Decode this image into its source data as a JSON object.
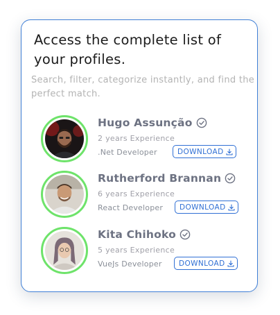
{
  "card": {
    "title": "Access the complete list of your profiles.",
    "subtitle": "Search, filter, categorize instantly, and find the perfect match."
  },
  "profiles": [
    {
      "name": "Hugo Assunção",
      "experience": "2 years Experience",
      "role": ".Net Developer",
      "download_label": "DOWNLOAD",
      "icon": "check-circle-icon"
    },
    {
      "name": "Rutherford Brannan",
      "experience": "6 years Experience",
      "role": "React Developer",
      "download_label": "DOWNLOAD",
      "icon": "check-circle-icon"
    },
    {
      "name": "Kita Chihoko",
      "experience": "5 years Experience",
      "role": "VueJs Developer",
      "download_label": "DOWNLOAD",
      "icon": "check-circle-icon"
    }
  ],
  "colors": {
    "accent": "#2f6fd4",
    "card_border": "#3f7fd6",
    "avatar_ring": "#6ee36a",
    "name": "#6d7282"
  }
}
